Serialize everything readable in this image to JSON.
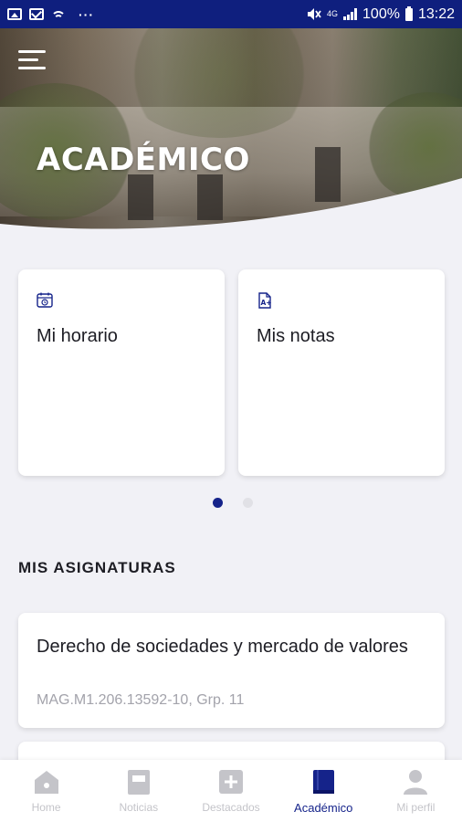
{
  "status_bar": {
    "battery": "100%",
    "time": "13:22",
    "network": "4G",
    "more": "···"
  },
  "header": {
    "title": "ACADÉMICO",
    "menu_icon": "hamburger-menu-icon"
  },
  "quick_cards": [
    {
      "label": "Mi horario",
      "icon": "calendar-clock-icon"
    },
    {
      "label": "Mis notas",
      "icon": "grade-document-icon"
    }
  ],
  "pager": {
    "pages": 2,
    "active": 1
  },
  "section": {
    "title": "MIS ASIGNATURAS"
  },
  "subjects": [
    {
      "name": "Derecho de sociedades y mercado de valores",
      "code": "MAG.M1.206.13592-10, Grp. 11"
    }
  ],
  "bottom_nav": {
    "items": [
      {
        "label": "Home",
        "icon": "home-icon",
        "active": false
      },
      {
        "label": "Noticias",
        "icon": "news-icon",
        "active": false
      },
      {
        "label": "Destacados",
        "icon": "plus-square-icon",
        "active": false
      },
      {
        "label": "Académico",
        "icon": "book-icon",
        "active": true
      },
      {
        "label": "Mi perfil",
        "icon": "user-icon",
        "active": false
      }
    ]
  },
  "colors": {
    "primary": "#15238a",
    "status_bar": "#0f1f7e",
    "background": "#f1f1f6",
    "inactive": "#c4c4c9",
    "pager_inactive": "#e1e1e6"
  }
}
